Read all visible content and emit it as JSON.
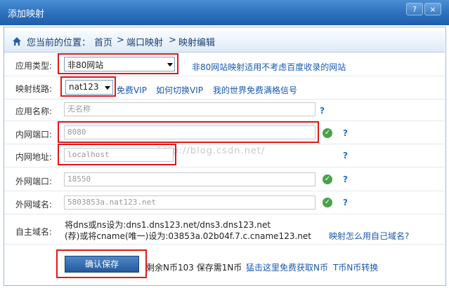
{
  "window": {
    "title": "添加映射",
    "buttons": {
      "help": "?",
      "close": "×"
    }
  },
  "breadcrumb": {
    "prefix": "您当前的位置：",
    "home": "首页",
    "sep": ">",
    "level1": "端口映射",
    "level2": "映射编辑"
  },
  "form": {
    "app_type": {
      "label": "应用类型:",
      "value": "非80网站",
      "note": "非80网站映射适用不考虑百度收录的网站"
    },
    "route": {
      "label": "映射线路:",
      "value": "nat123",
      "link_free_vip": "免费VIP",
      "link_switch_vip": "如何切换VIP",
      "link_world": "我的世界免费满格信号"
    },
    "app_name": {
      "label": "应用名称:",
      "placeholder": "无名称",
      "help": "?"
    },
    "lan_port": {
      "label": "内网端口:",
      "value": "8080",
      "help": "?"
    },
    "lan_addr": {
      "label": "内网地址:",
      "value": "localhost",
      "help": "?"
    },
    "wan_port": {
      "label": "外网端口:",
      "value": "18550",
      "help": "?"
    },
    "wan_domain": {
      "label": "外网域名:",
      "value": "5803853a.nat123.net",
      "help": "?"
    },
    "custom_domain": {
      "label": "自主域名:",
      "line1": "将dns或ns设为:dns1.dns123.net/dns3.dns123.net",
      "line2": "(荐)或将cname(唯一)设为:03853a.02b04f.7.c.cname123.net",
      "link_how": "映射怎么用自己域名?"
    }
  },
  "footer": {
    "save_label": "确认保存",
    "balance_text": "剩余N币103 保存需1N币",
    "link_get_free": "猛击这里免费获取N币",
    "link_convert": "T币N币转换"
  },
  "watermark": "http://blog.csdn.net/",
  "colors": {
    "titlebar": "#2c6fbd",
    "link": "#1758b0",
    "highlight": "#e01818",
    "check": "#4aa24a",
    "save_button": "#245a9c"
  },
  "icons": {
    "home": "home-icon",
    "check": "check-icon",
    "help": "question-icon",
    "dropdown": "chevron-down-icon"
  }
}
